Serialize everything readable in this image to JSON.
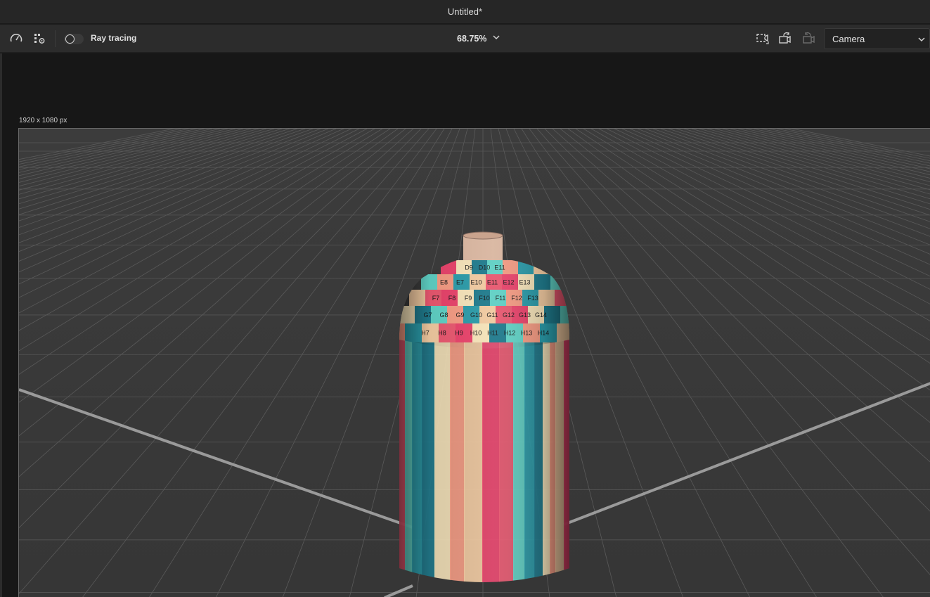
{
  "window": {
    "title": "Untitled*"
  },
  "toolbar": {
    "performance_icon": "gauge-icon",
    "render_settings_icon": "render-settings-icon",
    "ray_tracing": {
      "label": "Ray tracing",
      "enabled": false
    },
    "zoom": "68.75%",
    "camera_icons": [
      "frame-camera-icon",
      "save-camera-view-icon",
      "restore-camera-view-icon"
    ],
    "camera_select": {
      "selected": "Camera"
    }
  },
  "viewport": {
    "resolution_label": "1920 x 1080 px",
    "object": "bottle",
    "uv_labels": {
      "row_d": [
        "D9",
        "D10",
        "E11"
      ],
      "row_e": [
        "E8",
        "E7",
        "E10",
        "E11",
        "E12",
        "E13"
      ],
      "row_f": [
        "F7",
        "F8",
        "F9",
        "F10",
        "F11",
        "F12",
        "F13"
      ],
      "row_g": [
        "G7",
        "G8",
        "G9",
        "G10",
        "G11",
        "G12",
        "G13",
        "G14"
      ],
      "row_h": [
        "H7",
        "H8",
        "H9",
        "H10",
        "H11",
        "H12",
        "H13",
        "H14"
      ]
    }
  }
}
